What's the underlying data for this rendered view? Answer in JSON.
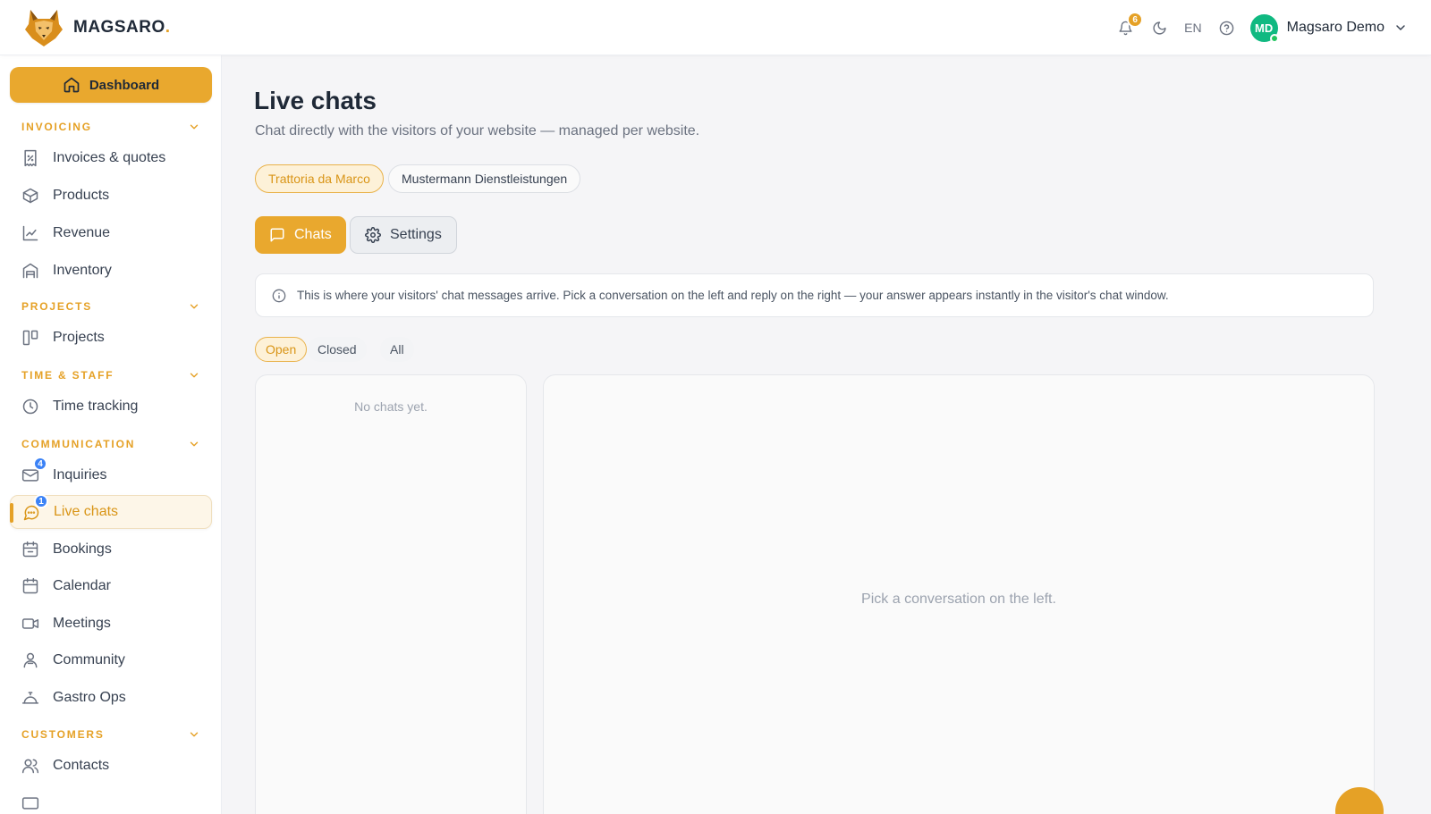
{
  "brand": {
    "name": "MAGSARO",
    "dot": "."
  },
  "topbar": {
    "notifications_count": "6",
    "language": "EN",
    "user": {
      "initials": "MD",
      "name": "Magsaro Demo"
    }
  },
  "sidebar": {
    "dashboard": "Dashboard",
    "sections": {
      "invoicing": "INVOICING",
      "projects": "PROJECTS",
      "time_staff": "TIME & STAFF",
      "communication": "COMMUNICATION",
      "customers": "CUSTOMERS"
    },
    "items": {
      "invoices": "Invoices & quotes",
      "products": "Products",
      "revenue": "Revenue",
      "inventory": "Inventory",
      "projects": "Projects",
      "time_tracking": "Time tracking",
      "inquiries": "Inquiries",
      "inquiries_badge": "4",
      "live_chats": "Live chats",
      "live_chats_badge": "1",
      "bookings": "Bookings",
      "calendar": "Calendar",
      "meetings": "Meetings",
      "community": "Community",
      "gastro_ops": "Gastro Ops",
      "contacts": "Contacts"
    }
  },
  "main": {
    "title": "Live chats",
    "subtitle": "Chat directly with the visitors of your website — managed per website.",
    "websites": [
      "Trattoria da Marco",
      "Mustermann Dienstleistungen"
    ],
    "tabs": {
      "chats": "Chats",
      "settings": "Settings"
    },
    "info": "This is where your visitors' chat messages arrive. Pick a conversation on the left and reply on the right — your answer appears instantly in the visitor's chat window.",
    "filters": {
      "open": "Open",
      "closed": "Closed",
      "all": "All"
    },
    "empty_list": "No chats yet.",
    "empty_conversation": "Pick a conversation on the left."
  },
  "colors": {
    "accent": "#e5a126",
    "badge_blue": "#3b82f6",
    "avatar_green": "#10b981"
  }
}
